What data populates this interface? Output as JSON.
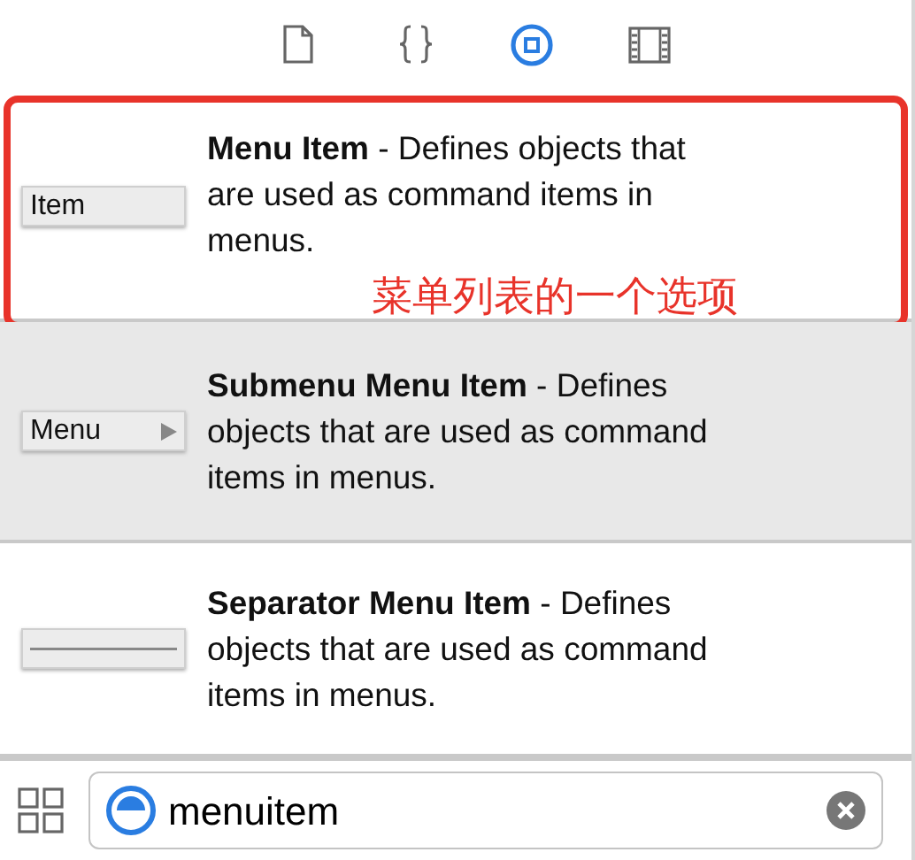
{
  "tabs": [
    {
      "kind": "file",
      "selected": false
    },
    {
      "kind": "braces",
      "selected": false
    },
    {
      "kind": "object",
      "selected": true
    },
    {
      "kind": "media",
      "selected": false
    }
  ],
  "items": [
    {
      "kind": "item",
      "preview_label": "Item",
      "description": "**Menu Item** - Defines objects that are used as command items in menus.",
      "selected": false,
      "annotation": "菜单列表的一个选项"
    },
    {
      "kind": "submenu",
      "preview_label": "Menu",
      "description": "**Submenu Menu Item** - Defines objects that are used as command items in menus.",
      "selected": true
    },
    {
      "kind": "separator",
      "description": "**Separator Menu Item** - Defines objects that are used as command items in menus.",
      "selected": false
    }
  ],
  "search": {
    "value": "menuitem"
  }
}
